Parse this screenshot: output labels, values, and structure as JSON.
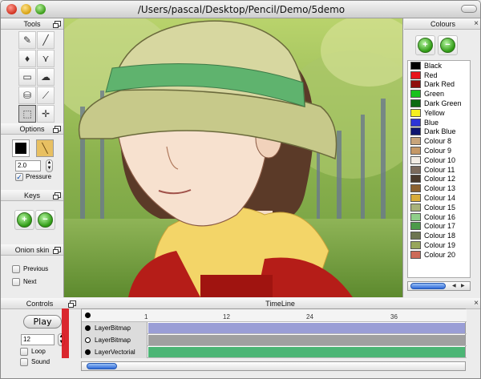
{
  "window": {
    "title": "/Users/pascal/Desktop/Pencil/Demo/5demo"
  },
  "tools": {
    "title": "Tools",
    "items": [
      {
        "icon": "pencil-icon",
        "glyph": "✎"
      },
      {
        "icon": "brush-icon",
        "glyph": "╱"
      },
      {
        "icon": "pen-icon",
        "glyph": "♦"
      },
      {
        "icon": "polyline-icon",
        "glyph": "⋎"
      },
      {
        "icon": "eraser-icon",
        "glyph": "▭"
      },
      {
        "icon": "smudge-icon",
        "glyph": "☁"
      },
      {
        "icon": "bucket-icon",
        "glyph": "⛁"
      },
      {
        "icon": "eyedropper-icon",
        "glyph": "⟋"
      },
      {
        "icon": "select-icon",
        "glyph": "⬚"
      },
      {
        "icon": "move-icon",
        "glyph": "✛"
      },
      {
        "icon": "hand-icon",
        "glyph": "✋"
      },
      {
        "icon": "mirror-icon",
        "glyph": "⇔"
      }
    ]
  },
  "options": {
    "title": "Options",
    "width_value": "2.0",
    "pressure_label": "Pressure",
    "pressure_checked": true,
    "current_colour": "#000000"
  },
  "keys": {
    "title": "Keys"
  },
  "onion": {
    "title": "Onion skin",
    "previous_label": "Previous",
    "next_label": "Next"
  },
  "colours": {
    "title": "Colours",
    "items": [
      {
        "name": "Black",
        "color": "#000000"
      },
      {
        "name": "Red",
        "color": "#e8141b"
      },
      {
        "name": "Dark Red",
        "color": "#8f0d0d"
      },
      {
        "name": "Green",
        "color": "#18c21d"
      },
      {
        "name": "Dark Green",
        "color": "#0d6b12"
      },
      {
        "name": "Yellow",
        "color": "#f6f01e"
      },
      {
        "name": "Blue",
        "color": "#2c34d6"
      },
      {
        "name": "Dark Blue",
        "color": "#0f1670"
      },
      {
        "name": "Colour 8",
        "color": "#c8a47a"
      },
      {
        "name": "Colour 9",
        "color": "#c59866"
      },
      {
        "name": "Colour 10",
        "color": "#f2ece4"
      },
      {
        "name": "Colour 11",
        "color": "#7b6a5c"
      },
      {
        "name": "Colour 12",
        "color": "#4a3a2c"
      },
      {
        "name": "Colour 13",
        "color": "#8c6230"
      },
      {
        "name": "Colour 14",
        "color": "#d8ac3a"
      },
      {
        "name": "Colour 15",
        "color": "#a8b27a"
      },
      {
        "name": "Colour 16",
        "color": "#8fcf8a"
      },
      {
        "name": "Colour 17",
        "color": "#4c9a4a"
      },
      {
        "name": "Colour 18",
        "color": "#6d7550"
      },
      {
        "name": "Colour 19",
        "color": "#98a65c"
      },
      {
        "name": "Colour 20",
        "color": "#cc6a58"
      }
    ]
  },
  "controls": {
    "title": "Controls",
    "play_label": "Play",
    "fps_value": "12",
    "loop_label": "Loop",
    "sound_label": "Sound"
  },
  "timeline": {
    "title": "TimeLine",
    "ticks": [
      "1",
      "12",
      "24",
      "36"
    ],
    "layers": [
      {
        "name": "LayerBitmap",
        "type": "bitmap",
        "color": "#9a9ed6",
        "filled_dot": true
      },
      {
        "name": "LayerBitmap",
        "type": "bitmap",
        "color": "#a0a0a0",
        "filled_dot": false
      },
      {
        "name": "LayerVectorial",
        "type": "vector",
        "color": "#4cb575",
        "filled_dot": true
      }
    ]
  }
}
